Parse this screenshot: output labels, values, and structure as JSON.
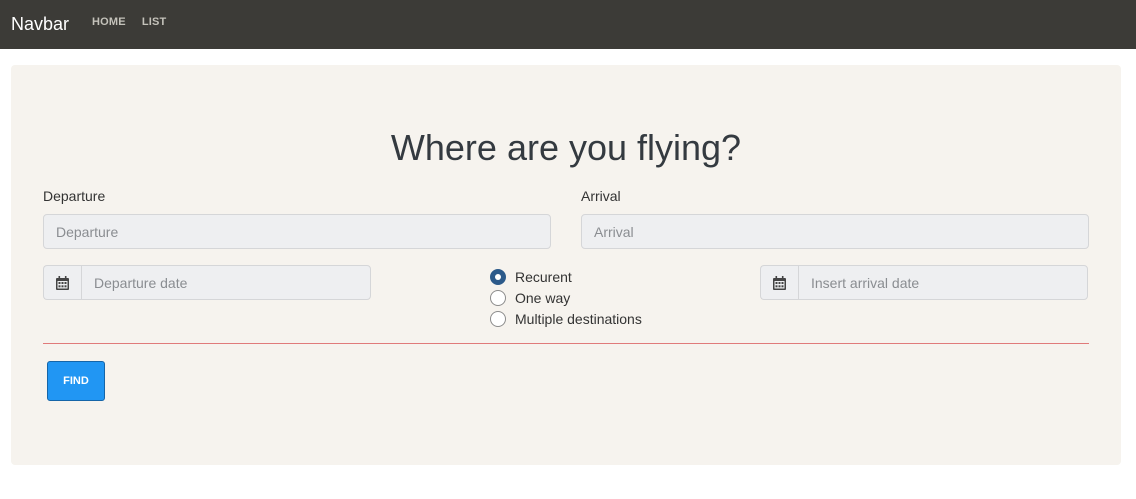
{
  "navbar": {
    "brand": "Navbar",
    "links": [
      "HOME",
      "LIST"
    ]
  },
  "main": {
    "title": "Where are you flying?",
    "departure": {
      "label": "Departure",
      "placeholder": "Departure"
    },
    "arrival": {
      "label": "Arrival",
      "placeholder": "Arrival"
    },
    "departure_date": {
      "placeholder": "Departure date",
      "icon": "calendar-icon"
    },
    "arrival_date": {
      "placeholder": "Insert arrival date",
      "icon": "calendar-icon"
    },
    "trip_type": {
      "options": [
        "Recurent",
        "One way",
        "Multiple destinations"
      ],
      "selected": "Recurent"
    },
    "find_label": "FIND"
  },
  "colors": {
    "navbar_bg": "#3c3b37",
    "card_bg": "#f6f3ee",
    "accent": "#2196f3",
    "radio_checked": "#2c5a8a",
    "divider": "#e07a7a"
  }
}
